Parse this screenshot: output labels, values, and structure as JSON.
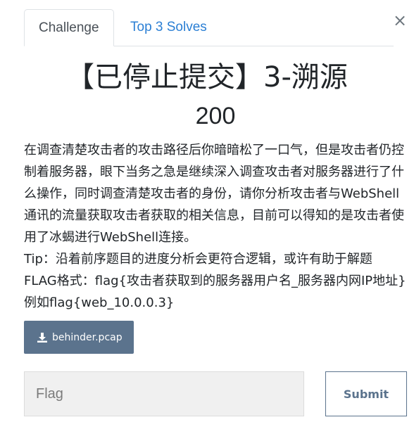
{
  "modal": {
    "close_symbol": "×",
    "tabs": [
      {
        "label": "Challenge",
        "active": true
      },
      {
        "label": "Top 3 Solves",
        "active": false
      }
    ],
    "title": "【已停止提交】3-溯源",
    "value": "200",
    "description": [
      "在调查清楚攻击者的攻击路径后你暗暗松了一口气，但是攻击者仍控制着服务器，眼下当务之急是继续深入调查攻击者对服务器进行了什么操作，同时调查清楚攻击者的身份，请你分析攻击者与WebShell通讯的流量获取攻击者获取的相关信息，目前可以得知的是攻击者使用了冰蝎进行WebShell连接。",
      "Tip：沿着前序题目的进度分析会更符合逻辑，或许有助于解题 FLAG格式：flag{攻击者获取到的服务器用户名_服务器内网IP地址} 例如flag{web_10.0.0.3}"
    ],
    "file": {
      "label": "behinder.pcap",
      "icon": "download-icon"
    },
    "flag_input": {
      "placeholder": "Flag",
      "value": ""
    },
    "submit_label": "Submit"
  },
  "colors": {
    "tab_link": "#2b7fd4",
    "file_button": "#5b738d",
    "submit_border": "#5b738d",
    "input_bg": "#f0f0f0"
  }
}
